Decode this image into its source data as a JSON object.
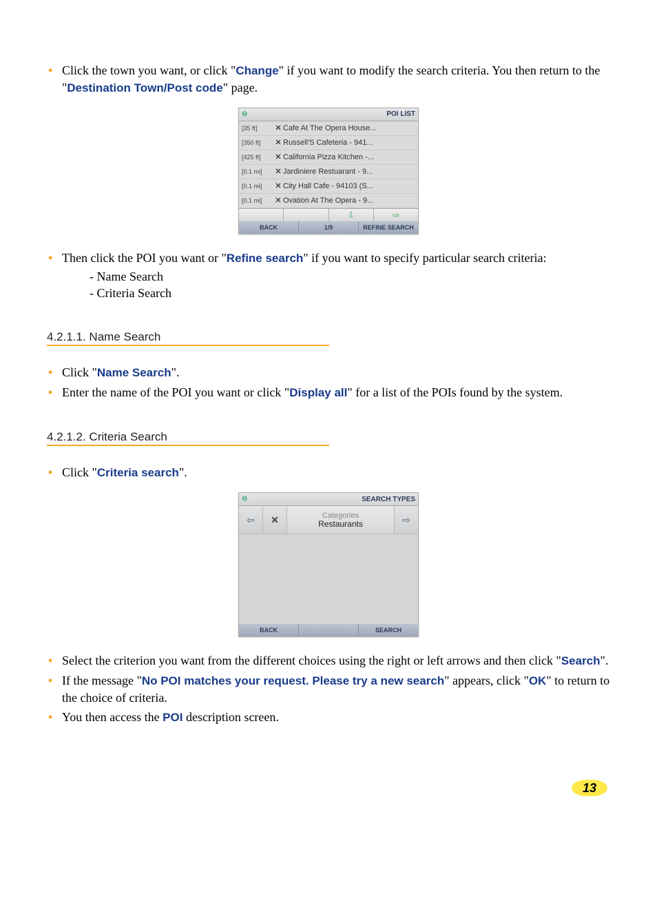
{
  "para1": {
    "pre": "Click the town you want, or click \"",
    "change": "Change",
    "mid": "\" if you want to modify the search criteria. You then return to the \"",
    "dest": "Destination Town/Post code",
    "post": "\" page."
  },
  "poi_list_screen": {
    "title": "POI LIST",
    "rows": [
      {
        "dist": "[35 ft]",
        "name": "Cafe At The Opera House..."
      },
      {
        "dist": "[350 ft]",
        "name": "Russell'S Cafeteria - 941..."
      },
      {
        "dist": "[425 ft]",
        "name": "California Pizza Kitchen -..."
      },
      {
        "dist": "[0.1 mi]",
        "name": "Jardiniere Restuarant - 9..."
      },
      {
        "dist": "[0.1 mi]",
        "name": "City Hall Cafe - 94103 (S..."
      },
      {
        "dist": "[0.1 mi]",
        "name": "Ovation At The Opera - 9..."
      }
    ],
    "footer": {
      "back": "BACK",
      "page": "1/9",
      "refine": "REFINE SEARCH"
    }
  },
  "para2": {
    "pre": "Then click the POI you want or \"",
    "refine": "Refine search",
    "post": "\" if you want to specify particular search criteria:"
  },
  "subitems": {
    "a": "-  Name Search",
    "b": "-  Criteria Search"
  },
  "heading1": "4.2.1.1. Name Search",
  "para3": {
    "pre": "Click \"",
    "term": "Name Search",
    "post": "\"."
  },
  "para4": {
    "pre": "Enter the name of the POI you want or click \"",
    "term": "Display all",
    "post": "\" for a list of the POIs found by the system."
  },
  "heading2": "4.2.1.2. Criteria Search",
  "para5": {
    "pre": "Click \"",
    "term": "Criteria search",
    "post": "\"."
  },
  "search_types_screen": {
    "title": "SEARCH TYPES",
    "cat_label": "Categories",
    "cat_value": "Restaurants",
    "footer": {
      "back": "BACK",
      "search": "SEARCH"
    }
  },
  "para6": {
    "pre": "Select the criterion you want from the different choices using the right or left arrows and then click \"",
    "term": "Search",
    "post": "\"."
  },
  "para7": {
    "pre": "If the message \"",
    "msg": "No POI matches your request. Please try a new search",
    "mid": "\" appears, click \"",
    "ok": "OK",
    "post": "\" to return to the choice of criteria."
  },
  "para8": {
    "pre": "You then access the ",
    "term": "POI",
    "post": " description screen."
  },
  "page_number": "13"
}
